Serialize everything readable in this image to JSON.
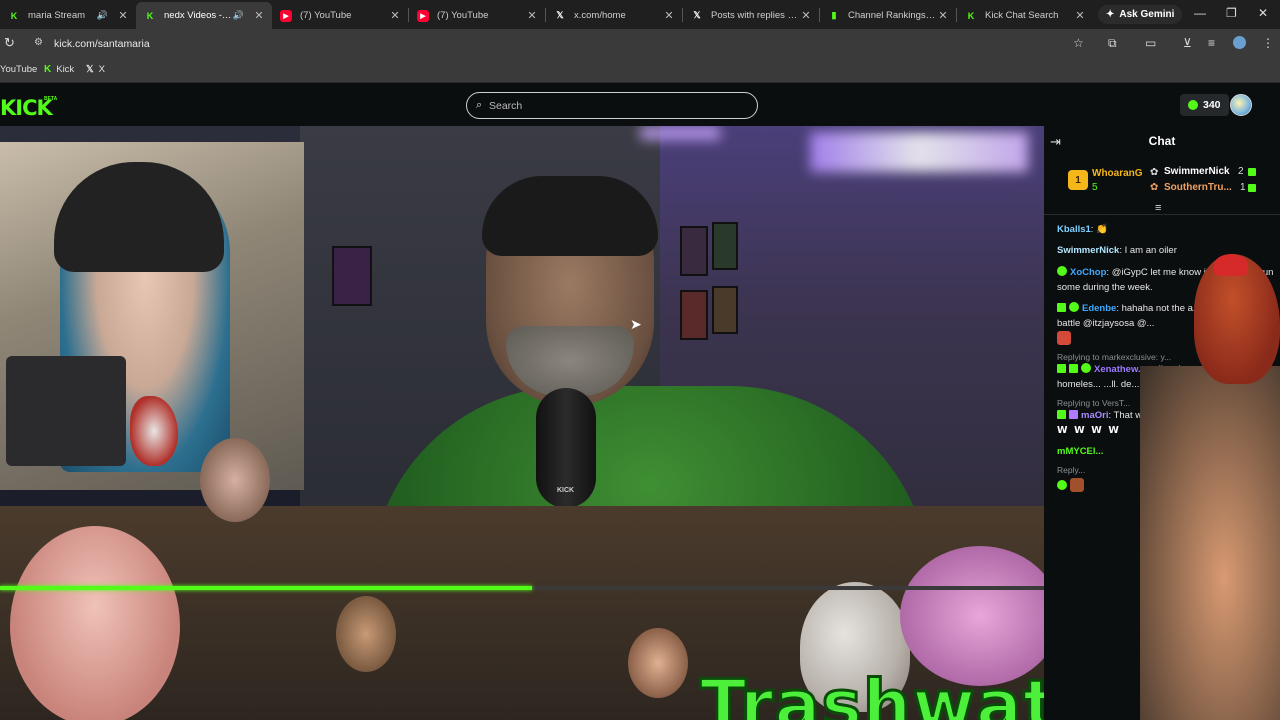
{
  "browser": {
    "tabs": [
      {
        "title": "maria Stream",
        "active": false,
        "audio": true,
        "icon": "kick-icon",
        "color": "#53fc18"
      },
      {
        "title": "nedx Videos - Wat",
        "active": true,
        "audio": true,
        "icon": "kick-icon",
        "color": "#53fc18"
      },
      {
        "title": "(7) YouTube",
        "active": false,
        "audio": false,
        "icon": "youtube-icon",
        "color": "#ff0033"
      },
      {
        "title": "(7) YouTube",
        "active": false,
        "audio": false,
        "icon": "youtube-icon",
        "color": "#ff0033"
      },
      {
        "title": "x.com/home",
        "active": false,
        "audio": false,
        "icon": "x-icon",
        "color": "#ffffff"
      },
      {
        "title": "Posts with replies by Tr",
        "active": false,
        "audio": false,
        "icon": "x-icon",
        "color": "#ffffff"
      },
      {
        "title": "Channel Rankings - Kic",
        "active": false,
        "audio": false,
        "icon": "chart-icon",
        "color": "#53fc18"
      },
      {
        "title": "Kick Chat Search",
        "active": false,
        "audio": false,
        "icon": "kick-icon",
        "color": "#53fc18"
      }
    ],
    "gemini_label": "Ask Gemini",
    "url": "kick.com/santamaria",
    "bookmarks": [
      {
        "label": "YouTube",
        "icon": "youtube-icon"
      },
      {
        "label": "Kick",
        "icon": "kick-icon"
      },
      {
        "label": "X",
        "icon": "x-icon"
      }
    ]
  },
  "kick": {
    "logo": "KICK",
    "beta": "BETA",
    "search_placeholder": "Search",
    "points": "340",
    "brand_color": "#53fc18"
  },
  "video": {
    "mic_label": "KICK",
    "overlay_text": "Trashwatch",
    "progress_fraction": 0.51
  },
  "chat": {
    "title": "Chat",
    "leaderboard": [
      {
        "rank": "1",
        "name": "WhoaranG",
        "count": "5",
        "color": "#f5b61a"
      },
      {
        "name": "SwimmerNick",
        "count": "2",
        "color": "#ffffff"
      },
      {
        "name": "SouthernTru...",
        "count": "1",
        "color": "#f0a060"
      }
    ],
    "messages": [
      {
        "user": "Kballs1",
        "text": "",
        "user_color": "#7fd1ff"
      },
      {
        "user": "SwimmerNick",
        "text": "I am an oiler",
        "user_color": "#b3e6ff"
      },
      {
        "user": "XoChop",
        "text": "@iGypC let me know if you wanna run some during the week.",
        "user_color": "#3fa9ff"
      },
      {
        "user": "Edenbe",
        "text": "hahaha not the a... orange juice battle @itzjaysosa @...",
        "user_color": "#3fa9ff"
      },
      {
        "reply": "Replying to markexclusive: y...",
        "user": "Xenathew...",
        "text": "yall ...n't c... feeding the homeles... ...ll. de...",
        "user_color": "#9b7bff"
      },
      {
        "reply": "Replying to VersT...",
        "user": "maOri",
        "text": "That w...",
        "user_color": "#a88cff"
      },
      {
        "user": "mMYCEl...",
        "text": "",
        "user_color": "#53fc18"
      },
      {
        "reply": "Reply..."
      }
    ]
  }
}
